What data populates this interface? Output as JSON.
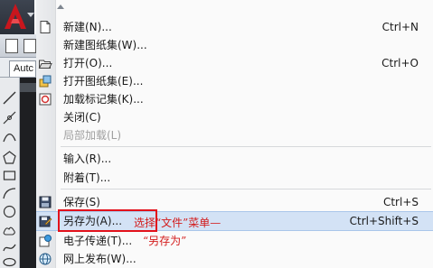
{
  "toolbar": {
    "tab_label": "Autc"
  },
  "menu": {
    "items": [
      {
        "label": "新建(N)...",
        "shortcut": "Ctrl+N",
        "icon": "new-file-icon"
      },
      {
        "label": "新建图纸集(W)...",
        "shortcut": "",
        "icon": ""
      },
      {
        "label": "打开(O)...",
        "shortcut": "Ctrl+O",
        "icon": "open-folder-icon"
      },
      {
        "label": "打开图纸集(E)...",
        "shortcut": "",
        "icon": "open-sheet-set-icon"
      },
      {
        "label": "加载标记集(K)...",
        "shortcut": "",
        "icon": "markup-set-icon"
      },
      {
        "label": "关闭(C)",
        "shortcut": "",
        "icon": ""
      },
      {
        "label": "局部加载(L)",
        "shortcut": "",
        "icon": "",
        "disabled": true
      },
      {
        "label": "输入(R)...",
        "shortcut": "",
        "icon": ""
      },
      {
        "label": "附着(T)...",
        "shortcut": "",
        "icon": ""
      },
      {
        "label": "保存(S)",
        "shortcut": "Ctrl+S",
        "icon": "save-disk-icon"
      },
      {
        "label": "另存为(A)...",
        "shortcut": "Ctrl+Shift+S",
        "icon": "save-as-icon",
        "highlighted": true
      },
      {
        "label": "电子传递(T)...",
        "shortcut": "",
        "icon": "etransmit-icon"
      },
      {
        "label": "网上发布(W)...",
        "shortcut": "",
        "icon": "publish-web-icon"
      }
    ]
  },
  "annotation": {
    "line1": "选择“文件”菜单—",
    "line2": "“另存为”"
  },
  "colors": {
    "highlight": "#d3e2f5",
    "annotation_red": "#d31b1b",
    "app_logo_red": "#c8161d"
  }
}
